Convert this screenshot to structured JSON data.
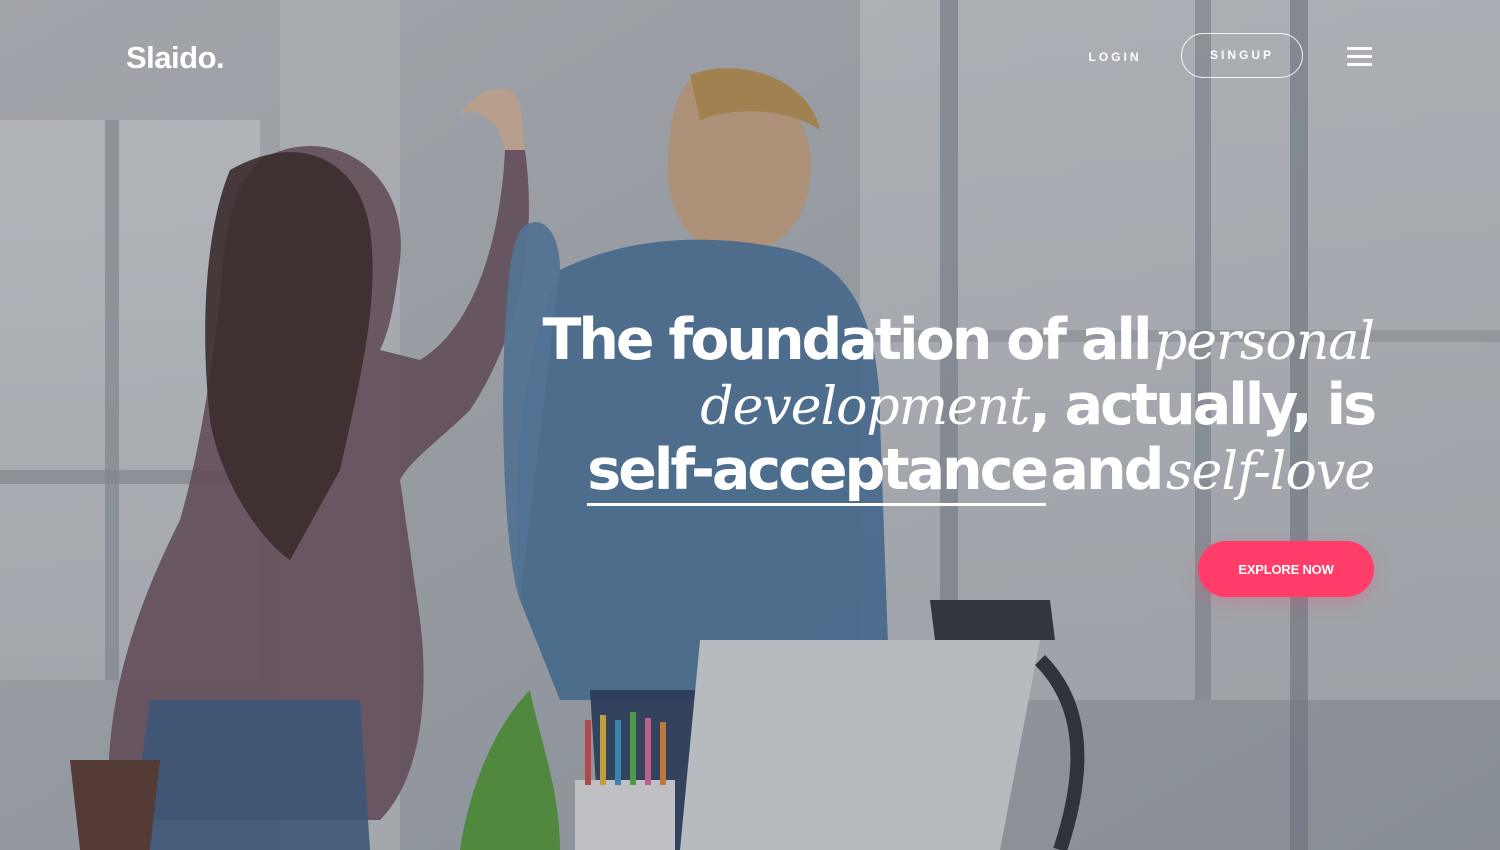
{
  "header": {
    "logo": "Slaido.",
    "login_label": "LOGIN",
    "signup_label": "SINGUP",
    "menu_icon": "hamburger-menu-icon"
  },
  "hero": {
    "headline": {
      "line1_bold": "The foundation of all",
      "line1_italic": "personal",
      "line2_italic": "development",
      "line2_bold": ", actually, is",
      "line3_underlined": "self-acceptance",
      "line3_bold": "and",
      "line3_italic": "self-love"
    },
    "cta_label": "EXPLORE NOW"
  },
  "colors": {
    "accent": "#ff3d68",
    "text": "#ffffff"
  }
}
